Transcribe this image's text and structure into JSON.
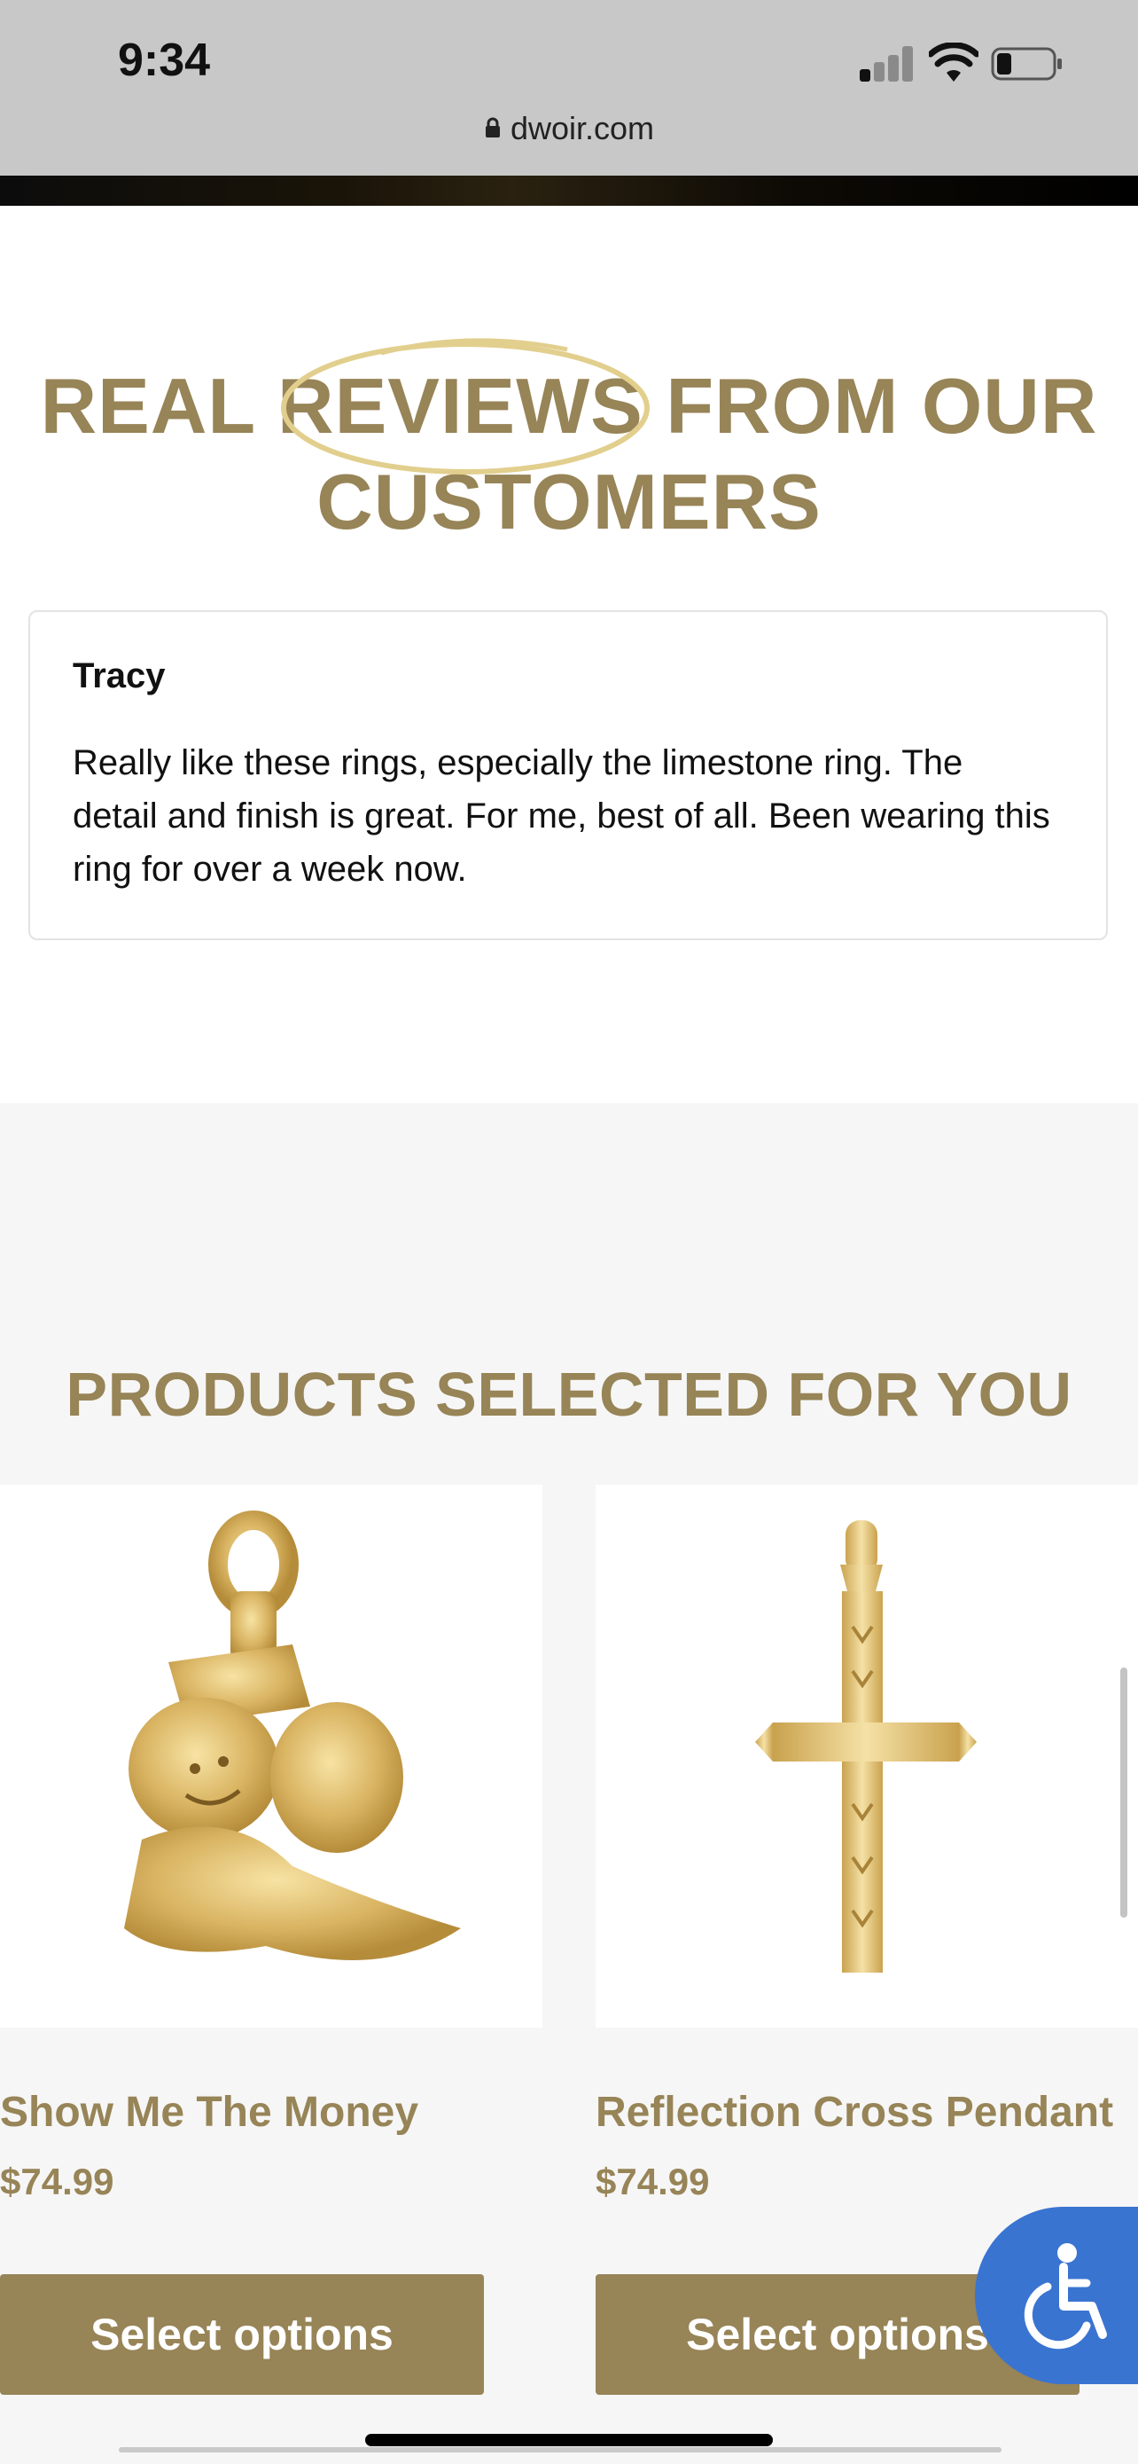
{
  "status_bar": {
    "time": "9:34",
    "url": "dwoir.com"
  },
  "reviews": {
    "title_words": [
      "REAL",
      "REVIEWS",
      "FROM OUR"
    ],
    "title_line2": "CUSTOMERS",
    "items": [
      {
        "name": "Tracy",
        "text": "Really like these rings, especially the limestone ring. The detail and finish is great. For me, best of all. Been wearing this ring for over a week now."
      }
    ]
  },
  "products": {
    "title": "PRODUCTS SELECTED FOR YOU",
    "items": [
      {
        "name": "Show Me The Money",
        "price": "$74.99",
        "button": "Select options",
        "image_icon": "money-character-pendant-icon"
      },
      {
        "name": "Reflection Cross Pendant",
        "price": "$74.99",
        "button": "Select options",
        "image_icon": "cross-pendant-icon"
      }
    ]
  },
  "colors": {
    "gold": "#978457",
    "accessibility_blue": "#3a74d1"
  },
  "accessibility_button_icon": "wheelchair-icon"
}
